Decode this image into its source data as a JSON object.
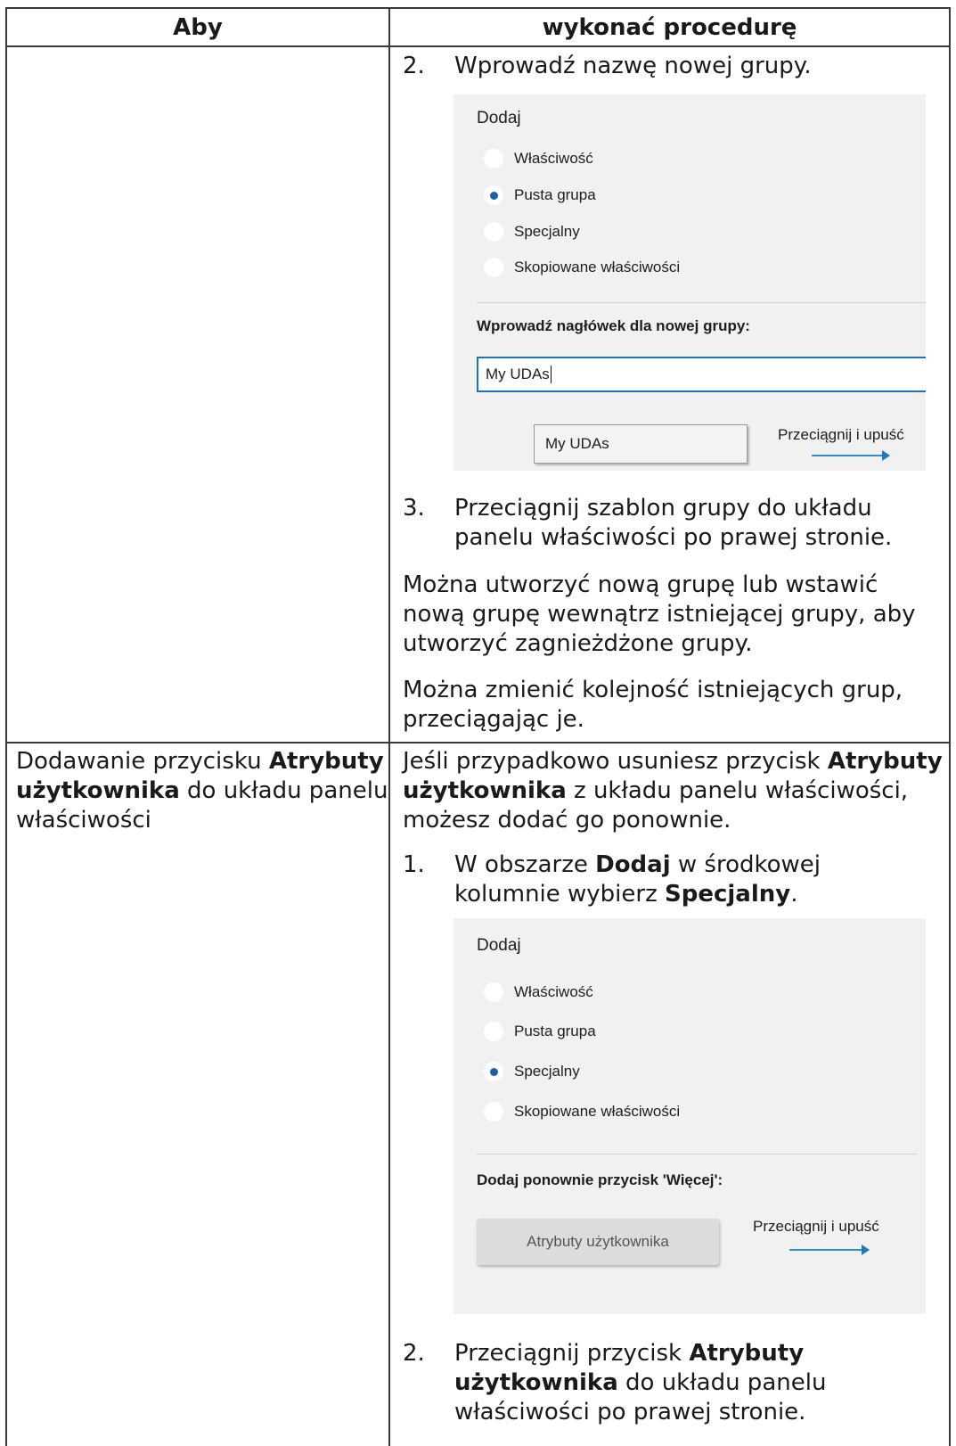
{
  "table": {
    "headers": [
      "Aby",
      "wykonać procedurę"
    ],
    "row1": {
      "step2": {
        "num": "2.",
        "text": "Wprowadź nazwę nowej grupy."
      },
      "shot": {
        "title": "Dodaj",
        "options": [
          "Właściwość",
          "Pusta grupa",
          "Specjalny",
          "Skopiowane właściwości"
        ],
        "selected": "Pusta grupa",
        "field_label": "Wprowadź nagłówek dla nowej grupy:",
        "field_value": "My UDAs",
        "template_label": "My UDAs",
        "drag_label": "Przeciągnij i upuść"
      },
      "step3": {
        "num": "3.",
        "text": "Przeciągnij szablon grupy do układu panelu właściwości po prawej stronie."
      },
      "para1": "Można utworzyć nową grupę lub wstawić nową grupę wewnątrz istniejącej grupy, aby utworzyć zagnieżdżone grupy.",
      "para2": "Można zmienić kolejność istniejących grup, przeciągając je."
    },
    "row2": {
      "task": {
        "prefix": "Dodawanie przycisku ",
        "bold": "Atrybuty użytkownika",
        "suffix": " do układu panelu właściwości"
      },
      "intro": {
        "prefix": "Jeśli przypadkowo usuniesz przycisk ",
        "bold": "Atrybuty użytkownika",
        "suffix": " z układu panelu właściwości, możesz dodać go ponownie."
      },
      "step1": {
        "num": "1.",
        "p1": "W obszarze ",
        "b1": "Dodaj",
        "p2": " w środkowej kolumnie wybierz ",
        "b2": "Specjalny",
        "p3": "."
      },
      "shot": {
        "title": "Dodaj",
        "options": [
          "Właściwość",
          "Pusta grupa",
          "Specjalny",
          "Skopiowane właściwości"
        ],
        "selected": "Specjalny",
        "field_label": "Dodaj ponownie przycisk 'Więcej':",
        "button_label": "Atrybuty użytkownika",
        "drag_label": "Przeciągnij i upuść"
      },
      "step2": {
        "num": "2.",
        "p1": "Przeciągnij przycisk ",
        "b1": "Atrybuty użytkownika",
        "p2": " do układu panelu właściwości po prawej stronie."
      }
    }
  }
}
